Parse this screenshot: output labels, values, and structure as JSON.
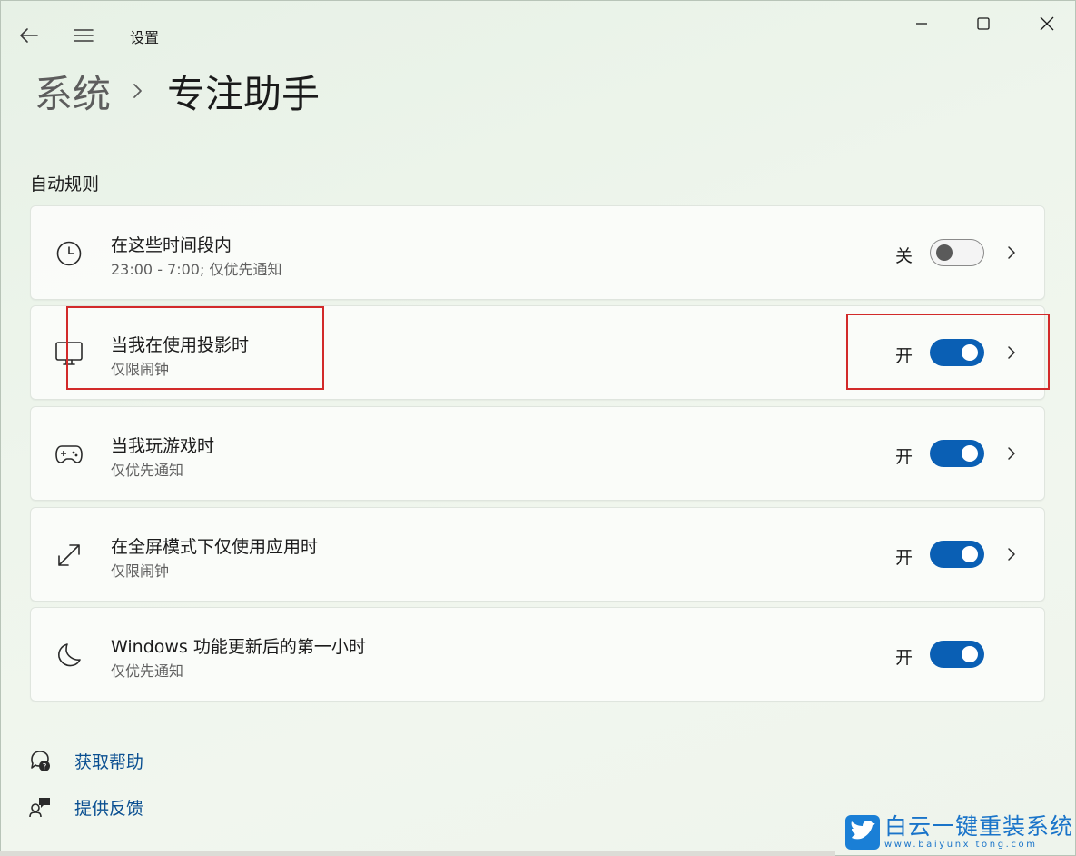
{
  "window": {
    "title": "设置"
  },
  "breadcrumb": {
    "parent": "系统",
    "current": "专注助手"
  },
  "section": {
    "title": "自动规则"
  },
  "rules": [
    {
      "icon": "clock-icon",
      "title": "在这些时间段内",
      "subtitle": "23:00 - 7:00; 仅优先通知",
      "state_label": "关",
      "on": false,
      "has_chevron": true
    },
    {
      "icon": "monitor-icon",
      "title": "当我在使用投影时",
      "subtitle": "仅限闹钟",
      "state_label": "开",
      "on": true,
      "has_chevron": true
    },
    {
      "icon": "gamepad-icon",
      "title": "当我玩游戏时",
      "subtitle": "仅优先通知",
      "state_label": "开",
      "on": true,
      "has_chevron": true
    },
    {
      "icon": "expand-icon",
      "title": "在全屏模式下仅使用应用时",
      "subtitle": "仅限闹钟",
      "state_label": "开",
      "on": true,
      "has_chevron": true
    },
    {
      "icon": "moon-icon",
      "title": "Windows 功能更新后的第一小时",
      "subtitle": "仅优先通知",
      "state_label": "开",
      "on": true,
      "has_chevron": false
    }
  ],
  "footer": {
    "help": "获取帮助",
    "feedback": "提供反馈"
  },
  "watermark": {
    "title": "白云一键重装系统",
    "url": "www.baiyunxitong.com"
  },
  "colors": {
    "accent": "#0a5fb4",
    "link": "#0a4f91",
    "highlight": "#d22a2a"
  }
}
